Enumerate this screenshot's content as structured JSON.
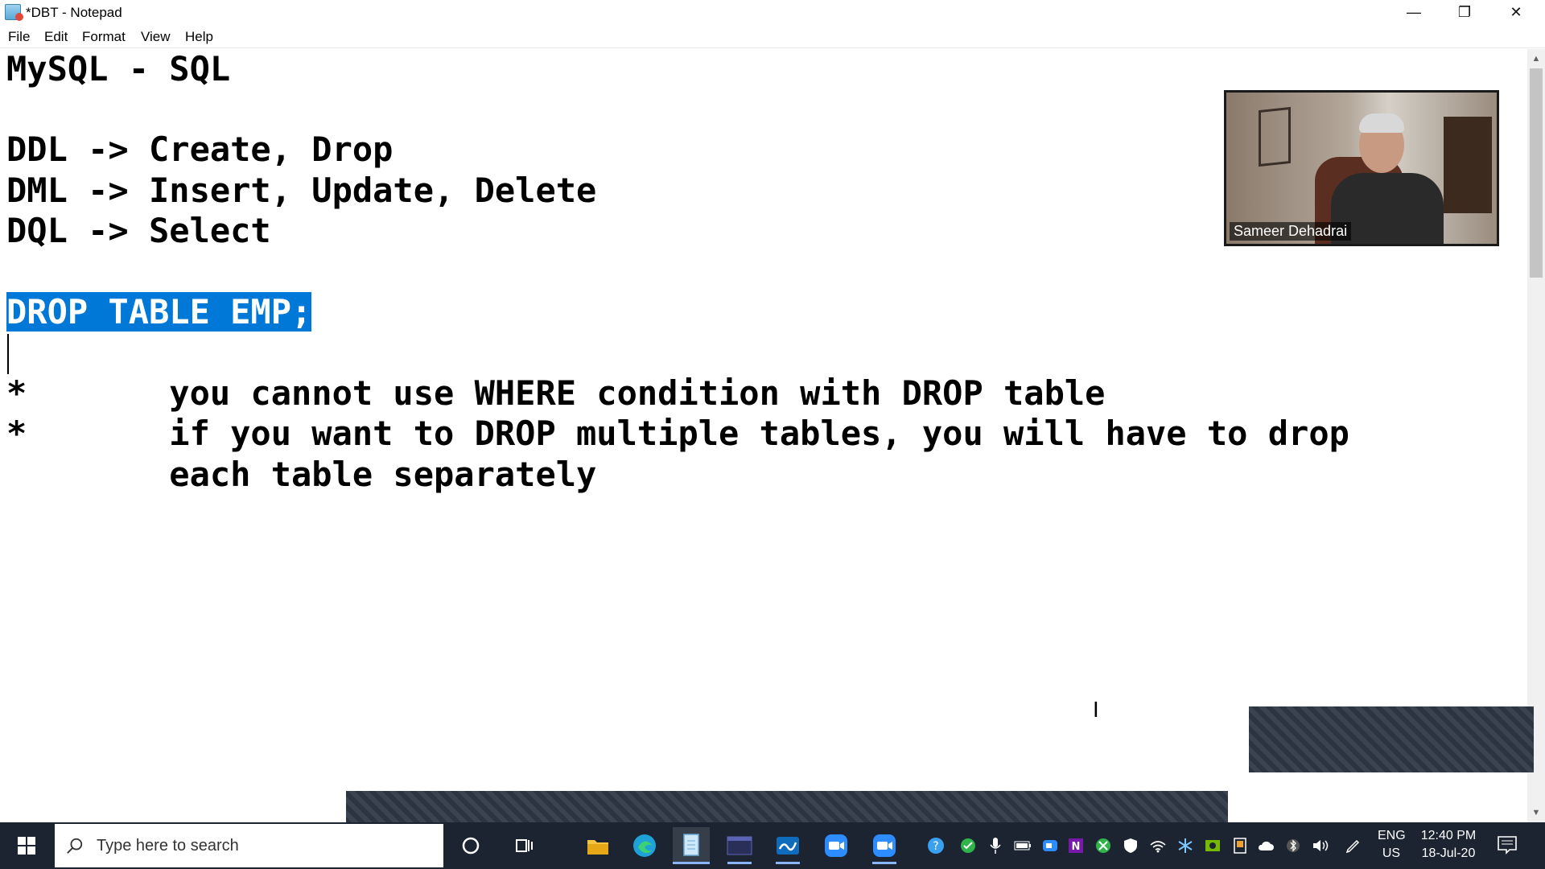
{
  "window": {
    "title": "*DBT - Notepad",
    "controls": {
      "minimize": "—",
      "maximize": "❐",
      "close": "✕"
    }
  },
  "menu": {
    "items": [
      "File",
      "Edit",
      "Format",
      "View",
      "Help"
    ]
  },
  "editor": {
    "lines": [
      "MySQL - SQL",
      "",
      "DDL -> Create, Drop",
      "DML -> Insert, Update, Delete",
      "DQL -> Select",
      "",
      "DROP TABLE EMP;",
      "",
      "*       you cannot use WHERE condition with DROP table",
      "*       if you want to DROP multiple tables, you will have to drop",
      "        each table separately"
    ],
    "selected_line_index": 6,
    "selection_color": "#0078d7"
  },
  "video_overlay": {
    "participant_name": "Sameer Dehadrai"
  },
  "taskbar": {
    "search_placeholder": "Type here to search",
    "apps": [
      "cortana-icon",
      "task-view-icon",
      "file-explorer-icon",
      "edge-icon",
      "notepad-icon",
      "terminal-icon",
      "whiteboard-icon",
      "zoom-icon",
      "zoom-meetings-icon"
    ],
    "tray_icons": [
      "help-icon",
      "shield-check-icon",
      "microphone-icon",
      "battery-icon",
      "camera-icon",
      "onenote-icon",
      "xbox-icon",
      "defender-icon",
      "wifi-icon",
      "snowflake-icon",
      "nvidia-icon",
      "tablet-icon",
      "cloud-icon",
      "bluetooth-icon",
      "speaker-icon",
      "pen-icon"
    ],
    "language": {
      "line1": "ENG",
      "line2": "US"
    },
    "clock": {
      "time": "12:40 PM",
      "date": "18-Jul-20"
    }
  },
  "colors": {
    "taskbar_bg": "#1b2430",
    "selection": "#0078d7",
    "editor_bg": "#ffffff"
  }
}
